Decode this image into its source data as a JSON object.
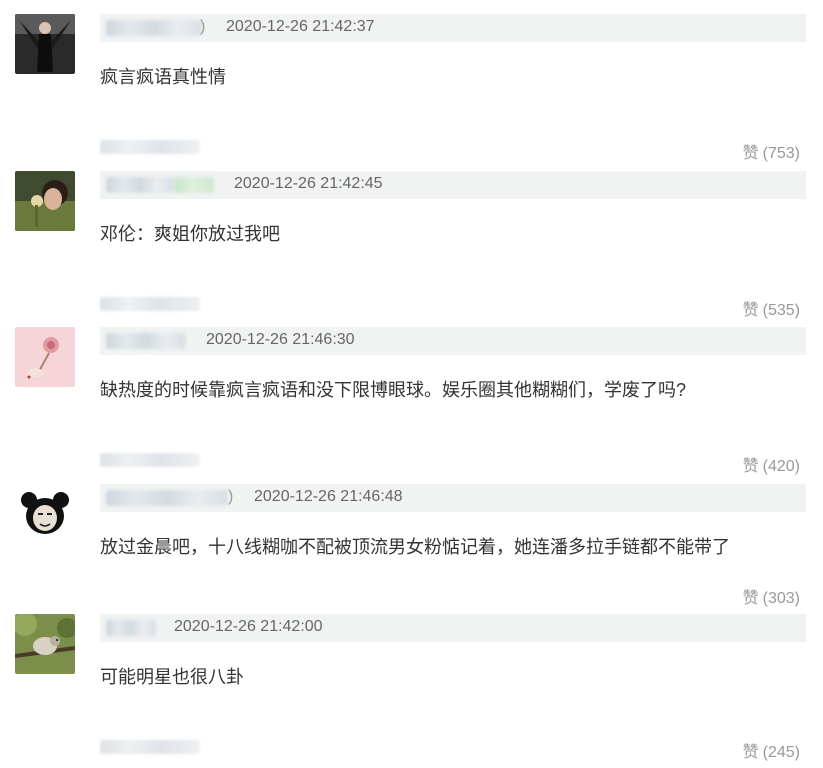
{
  "comments": [
    {
      "time": "2020-12-26 21:42:37",
      "text": "疯言疯语真性情",
      "like_label": "赞",
      "like_count": "(753)",
      "paren": ")"
    },
    {
      "time": "2020-12-26 21:42:45",
      "text": "邓伦：爽姐你放过我吧",
      "like_label": "赞",
      "like_count": "(535)",
      "paren": ""
    },
    {
      "time": "2020-12-26 21:46:30",
      "text": "缺热度的时候靠疯言疯语和没下限博眼球。娱乐圈其他糊糊们，学废了吗?",
      "like_label": "赞",
      "like_count": "(420)",
      "paren": ""
    },
    {
      "time": "2020-12-26 21:46:48",
      "text": "放过金晨吧，十八线糊咖不配被顶流男女粉惦记着，她连潘多拉手链都不能带了",
      "like_label": "赞",
      "like_count": "(303)",
      "paren": ")"
    },
    {
      "time": "2020-12-26 21:42:00",
      "text": "可能明星也很八卦",
      "like_label": "赞",
      "like_count": "(245)",
      "paren": ""
    }
  ],
  "icons": {
    "avatar_1": "avatar-dark-figure",
    "avatar_2": "avatar-woman-flower",
    "avatar_3": "avatar-pink-rose",
    "avatar_4": "avatar-panda-meme",
    "avatar_5": "avatar-bird-tree"
  }
}
